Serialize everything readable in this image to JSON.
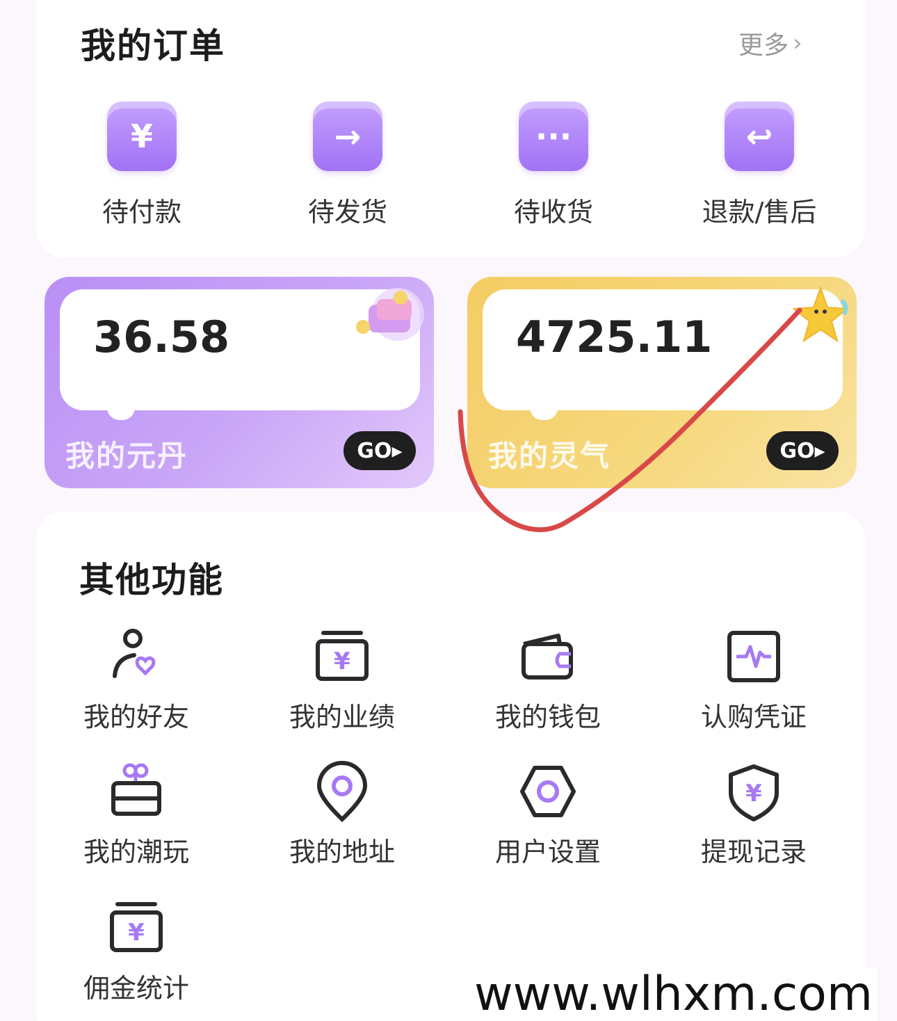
{
  "orders": {
    "title": "我的订单",
    "more_label": "更多",
    "items": [
      {
        "label": "待付款",
        "icon": "yen-icon",
        "glyph": "¥"
      },
      {
        "label": "待发货",
        "icon": "arrow-right-icon",
        "glyph": "→"
      },
      {
        "label": "待收货",
        "icon": "dots-icon",
        "glyph": "···"
      },
      {
        "label": "退款/售后",
        "icon": "return-icon",
        "glyph": "↩"
      }
    ]
  },
  "assets": {
    "yuandan": {
      "value": "36.58",
      "name": "我的元丹",
      "go_label": "GO▸"
    },
    "lingqi": {
      "value": "4725.11",
      "name": "我的灵气",
      "go_label": "GO▸"
    }
  },
  "other": {
    "title": "其他功能",
    "items": [
      {
        "label": "我的好友",
        "icon": "friend-heart-icon"
      },
      {
        "label": "我的业绩",
        "icon": "yen-box-icon"
      },
      {
        "label": "我的钱包",
        "icon": "wallet-icon"
      },
      {
        "label": "认购凭证",
        "icon": "pulse-icon"
      },
      {
        "label": "我的潮玩",
        "icon": "gift-icon"
      },
      {
        "label": "我的地址",
        "icon": "location-icon"
      },
      {
        "label": "用户设置",
        "icon": "settings-hex-icon"
      },
      {
        "label": "提现记录",
        "icon": "shield-yen-icon"
      },
      {
        "label": "佣金统计",
        "icon": "yen-box-icon"
      }
    ]
  },
  "colors": {
    "accent_purple": "#a679f5",
    "icon_dark": "#2a2a2a",
    "scribble_red": "#d94848"
  },
  "watermark": "www.wlhxm.com"
}
